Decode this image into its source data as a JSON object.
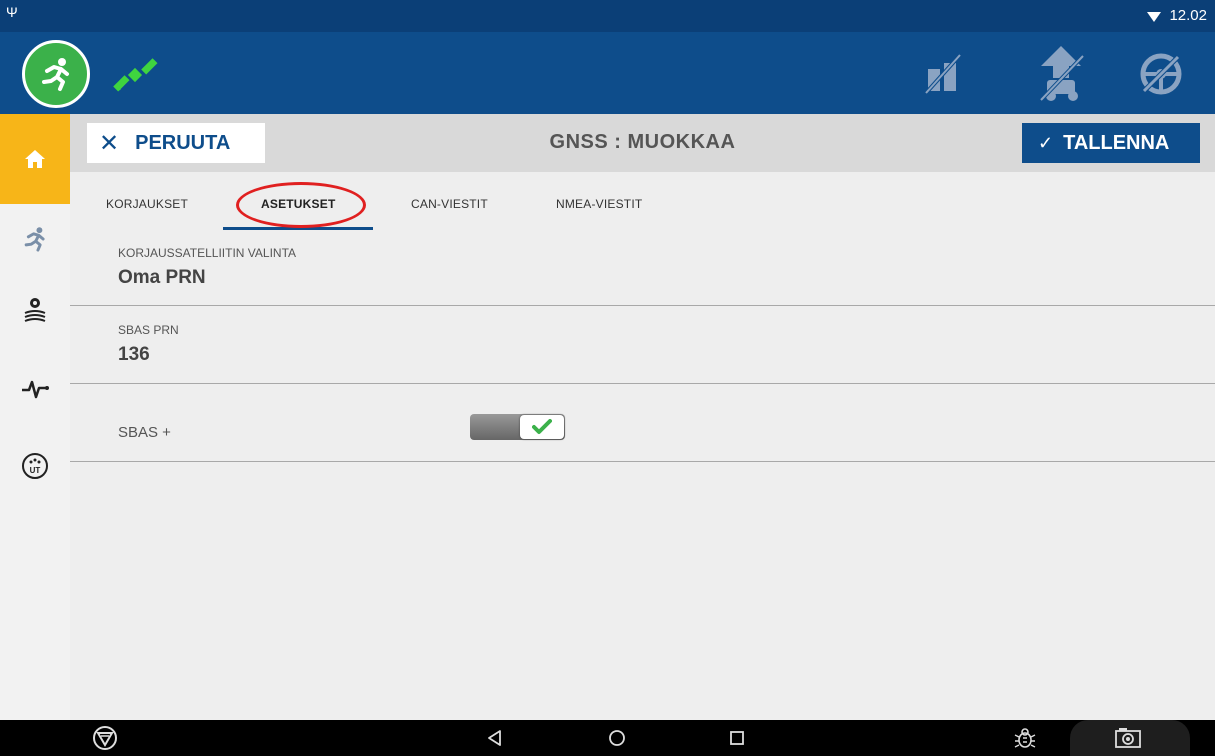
{
  "status_bar": {
    "usb_glyph": "Ψ",
    "time": "12.02"
  },
  "top_bar": {
    "run_icon": "running-person-icon",
    "satellite_icon": "satellite-icon",
    "right_icons": [
      "implement-disabled-icon",
      "tractor-guidance-disabled-icon",
      "steering-wheel-disabled-icon"
    ]
  },
  "sidebar": {
    "items": [
      "home-icon",
      "running-person-icon",
      "field-settings-icon",
      "pulse-icon",
      "ut-terminal-icon"
    ]
  },
  "header": {
    "cancel_label": "PERUUTA",
    "title": "GNSS : MUOKKAA",
    "save_label": "TALLENNA"
  },
  "tabs": [
    {
      "label": "KORJAUKSET",
      "active": false
    },
    {
      "label": "ASETUKSET",
      "active": true
    },
    {
      "label": "CAN-VIESTIT",
      "active": false
    },
    {
      "label": "NMEA-VIESTIT",
      "active": false
    }
  ],
  "settings": {
    "correction_satellite": {
      "label": "KORJAUSSATELLIITIN VALINTA",
      "value": "Oma PRN"
    },
    "sbas_prn": {
      "label": "SBAS PRN",
      "value": "136"
    },
    "sbas_plus": {
      "label": "SBAS +",
      "enabled": true
    }
  },
  "colors": {
    "brand_blue": "#0e4d8b",
    "accent_yellow": "#f7b518",
    "run_green": "#3bb14a",
    "highlight_red": "#e02020"
  }
}
